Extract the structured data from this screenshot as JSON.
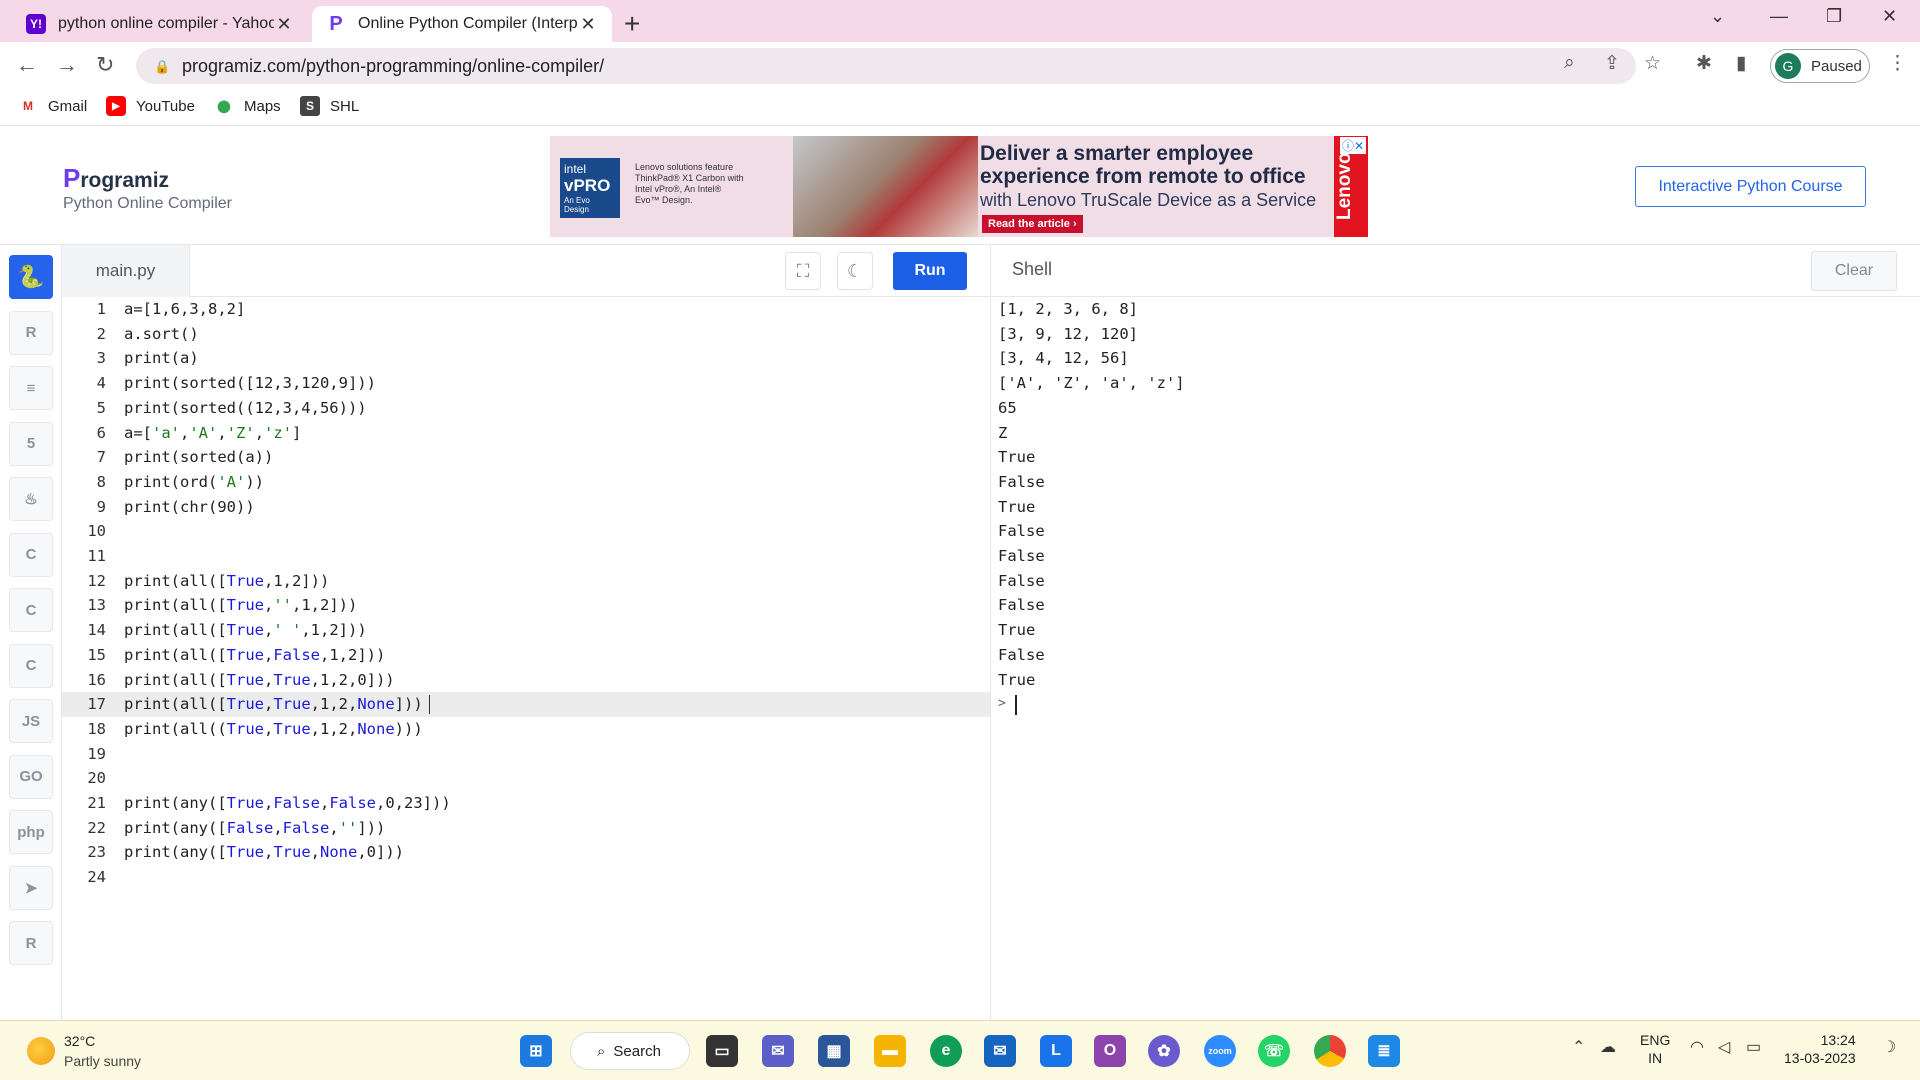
{
  "browser": {
    "tabs": [
      {
        "title": "python online compiler - Yahoo",
        "favicon": "Y!",
        "active": false
      },
      {
        "title": "Online Python Compiler (Interpre",
        "favicon": "P",
        "active": true
      }
    ],
    "url": "programiz.com/python-programming/online-compiler/",
    "profile": {
      "initial": "G",
      "status": "Paused"
    },
    "bookmarks": [
      {
        "label": "Gmail",
        "icon": "gmail-icon"
      },
      {
        "label": "YouTube",
        "icon": "youtube-icon"
      },
      {
        "label": "Maps",
        "icon": "maps-icon"
      },
      {
        "label": "SHL",
        "icon": "shl-icon"
      }
    ]
  },
  "page": {
    "logo": "rogramiz",
    "logo_letter": "P",
    "subtitle": "Python Online Compiler",
    "course_button": "Interactive Python Course",
    "ad": {
      "badge_brand": "intel",
      "badge_title": "vPRO",
      "badge_sub": "An Evo Design",
      "small_text": "Lenovo solutions feature ThinkPad® X1 Carbon with Intel vPro®, An Intel® Evo™ Design.",
      "headline": "Deliver a smarter employee experience from remote to office",
      "sub": "with Lenovo TruScale Device as a Service",
      "cta": "Read the article ›",
      "brand": "Lenovo"
    }
  },
  "sidebar": {
    "items": [
      {
        "icon": "python-icon",
        "label": "",
        "active": true
      },
      {
        "icon": "r-icon",
        "label": "R"
      },
      {
        "icon": "database-icon",
        "label": "≡"
      },
      {
        "icon": "html-icon",
        "label": "5"
      },
      {
        "icon": "java-icon",
        "label": "♨"
      },
      {
        "icon": "c-icon",
        "label": "C"
      },
      {
        "icon": "cpp-icon",
        "label": "C"
      },
      {
        "icon": "csharp-icon",
        "label": "C"
      },
      {
        "icon": "js-icon",
        "label": "JS"
      },
      {
        "icon": "go-icon",
        "label": "GO"
      },
      {
        "icon": "php-icon",
        "label": "php"
      },
      {
        "icon": "swift-icon",
        "label": "➤"
      },
      {
        "icon": "rust-icon",
        "label": "R"
      }
    ]
  },
  "editor": {
    "filename": "main.py",
    "run_label": "Run",
    "active_line": 17,
    "lines": [
      "a=[1,6,3,8,2]",
      "a.sort()",
      "print(a)",
      "print(sorted([12,3,120,9]))",
      "print(sorted((12,3,4,56)))",
      "a=['a','A','Z','z']",
      "print(sorted(a))",
      "print(ord('A'))",
      "print(chr(90))",
      "",
      "",
      "print(all([True,1,2]))",
      "print(all([True,'',1,2]))",
      "print(all([True,' ',1,2]))",
      "print(all([True,False,1,2]))",
      "print(all([True,True,1,2,0]))",
      "print(all([True,True,1,2,None]))",
      "print(all((True,True,1,2,None)))",
      "",
      "",
      "print(any([True,False,False,0,23]))",
      "print(any([False,False,'']))",
      "print(any([True,True,None,0]))",
      ""
    ]
  },
  "shell": {
    "title": "Shell",
    "clear_label": "Clear",
    "output": [
      "[1, 2, 3, 6, 8]",
      "[3, 9, 12, 120]",
      "[3, 4, 12, 56]",
      "['A', 'Z', 'a', 'z']",
      "65",
      "Z",
      "True",
      "False",
      "True",
      "False",
      "False",
      "False",
      "False",
      "True",
      "False",
      "True"
    ],
    "prompt": ">"
  },
  "taskbar": {
    "temperature": "32°C",
    "condition": "Partly sunny",
    "search_label": "Search",
    "lang_top": "ENG",
    "lang_bottom": "IN",
    "time": "13:24",
    "date": "13-03-2023"
  },
  "colors": {
    "accent": "#1a5fe6",
    "titlebar": "#f5d9e8",
    "keyword": "#1a1ad9",
    "string": "#1f7a1f"
  }
}
